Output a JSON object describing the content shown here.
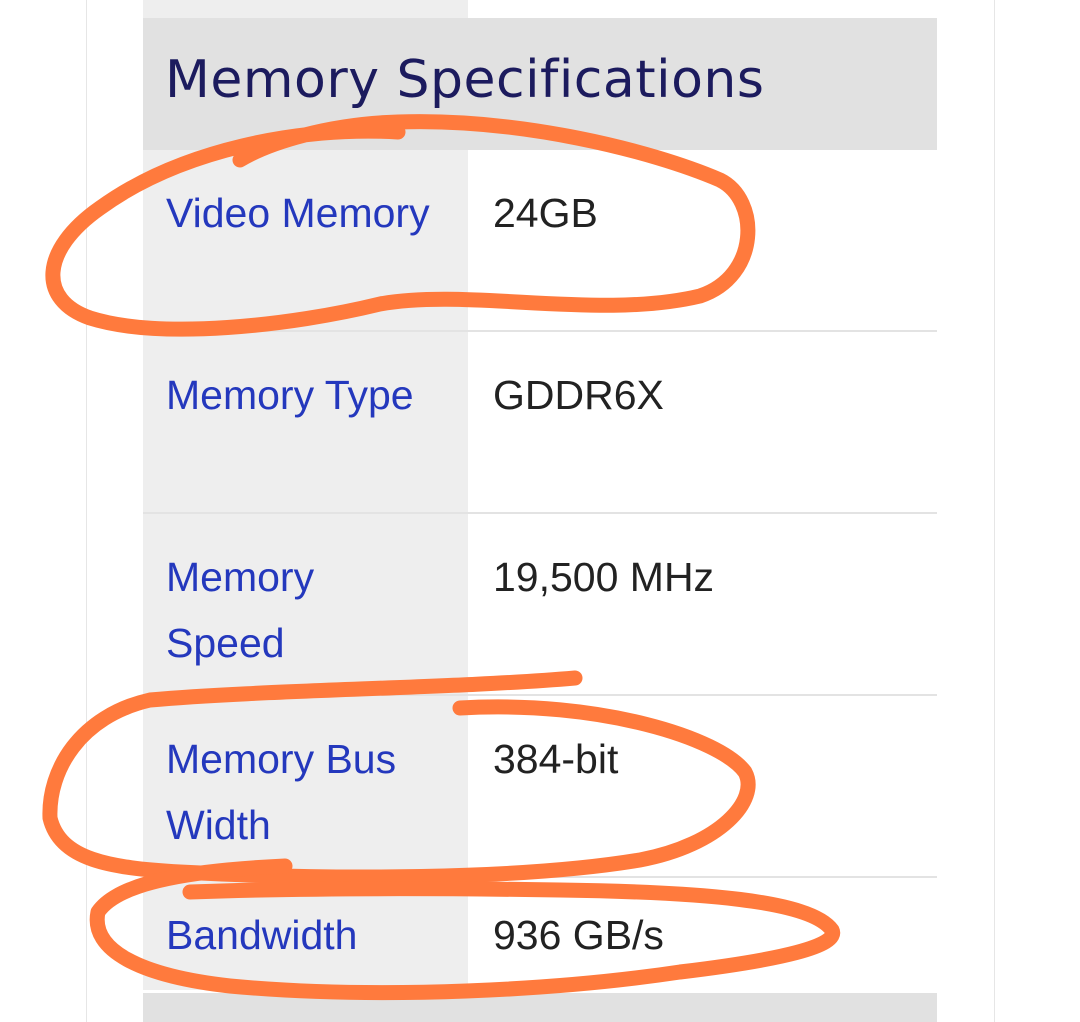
{
  "section": {
    "title": "Memory Specifications"
  },
  "rows": [
    {
      "label": "Video Memory",
      "value": "24GB"
    },
    {
      "label": "Memory Type",
      "value": "GDDR6X"
    },
    {
      "label": "Memory Speed",
      "value": "19,500 MHz"
    },
    {
      "label": "Memory Bus Width",
      "value": "384-bit"
    },
    {
      "label": "Bandwidth",
      "value": "936 GB/s"
    }
  ],
  "colors": {
    "label_link": "#2438bd",
    "title": "#1c1b5e",
    "annotation_marker": "#ff7a3d"
  }
}
